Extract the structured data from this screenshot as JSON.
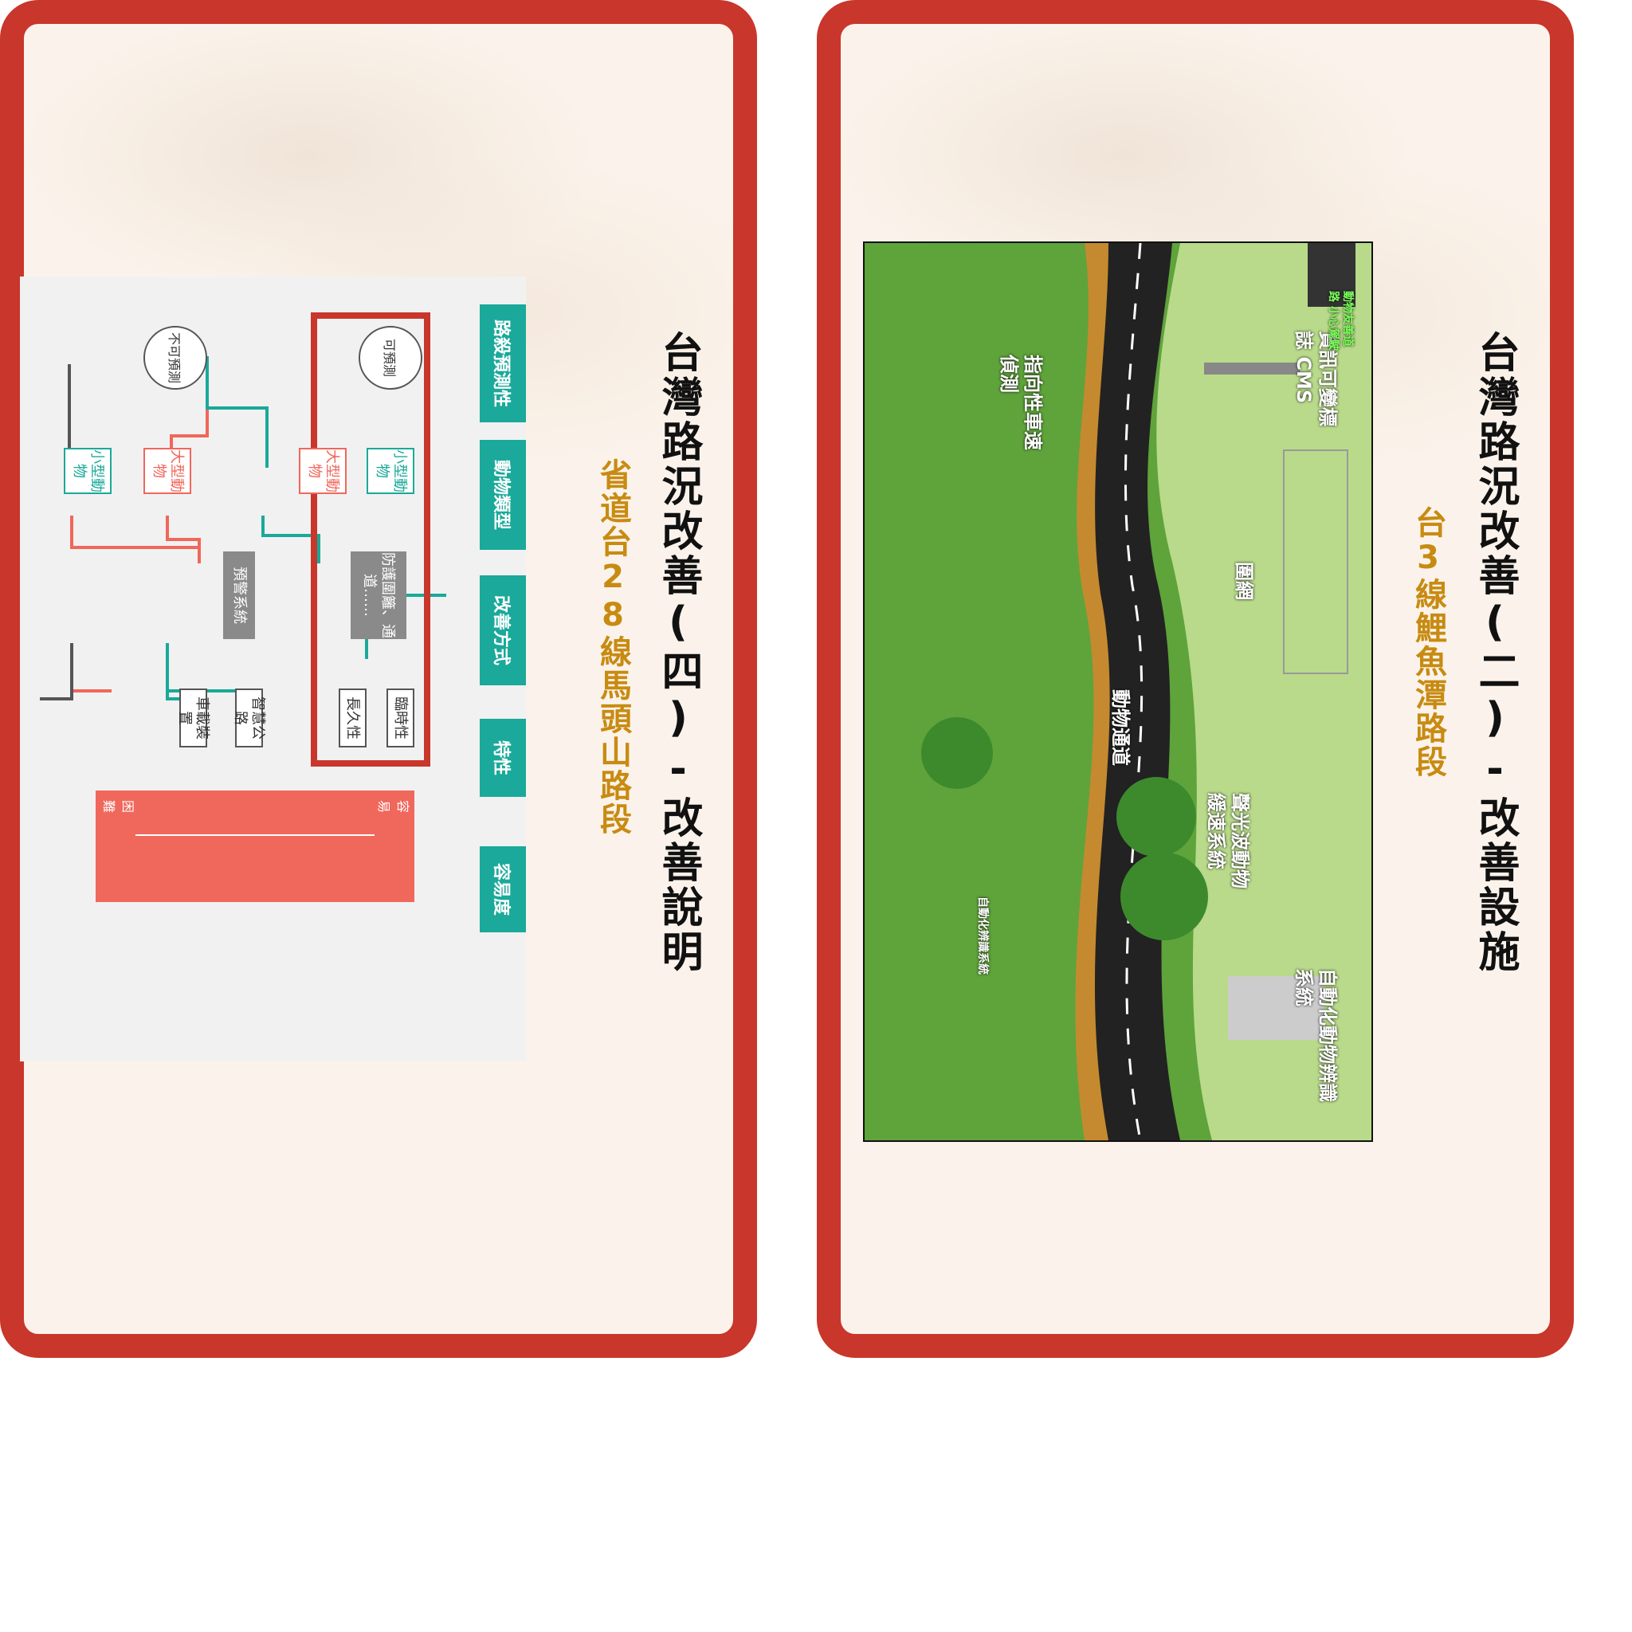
{
  "cards": [
    {
      "title": "台灣路況改善(四)-改善說明",
      "subtitle": "省道台28線馬頭山路段",
      "diagram": {
        "side_labels": [
          "路殺預測性",
          "動物類型",
          "改善方式",
          "特性",
          "容易度"
        ],
        "predictable": "可預測",
        "unpredictable": "不可預測",
        "small_animal": "小型動物",
        "large_animal": "大型動物",
        "fence_passage": "防護圍籬、通道……",
        "warning_system": "預警系統",
        "temporary": "臨時性",
        "permanent": "長久性",
        "smart_road": "智慧公路",
        "vehicle_device": "車載裝置",
        "easy": "容易",
        "hard": "困難"
      }
    },
    {
      "title": "台灣路況改善(二)-改善設施",
      "subtitle": "台3線鯉魚潭路段",
      "illustration": {
        "cms": "資訊可變標誌 CMS",
        "cms_sign": "動物友善道路 小心駕駛",
        "speed_detect": "指向性車速偵測",
        "fence": "圍網",
        "animal_passage": "動物通道",
        "sound_light": "聲光波動物緩速系統",
        "auto_id": "自動化動物辨識系統",
        "small_label": "自動化辨識系統"
      }
    }
  ],
  "colors": {
    "frame": "#c9362b",
    "teal": "#1aa99a",
    "coral": "#f0675b",
    "subtitle": "#c88b12"
  }
}
